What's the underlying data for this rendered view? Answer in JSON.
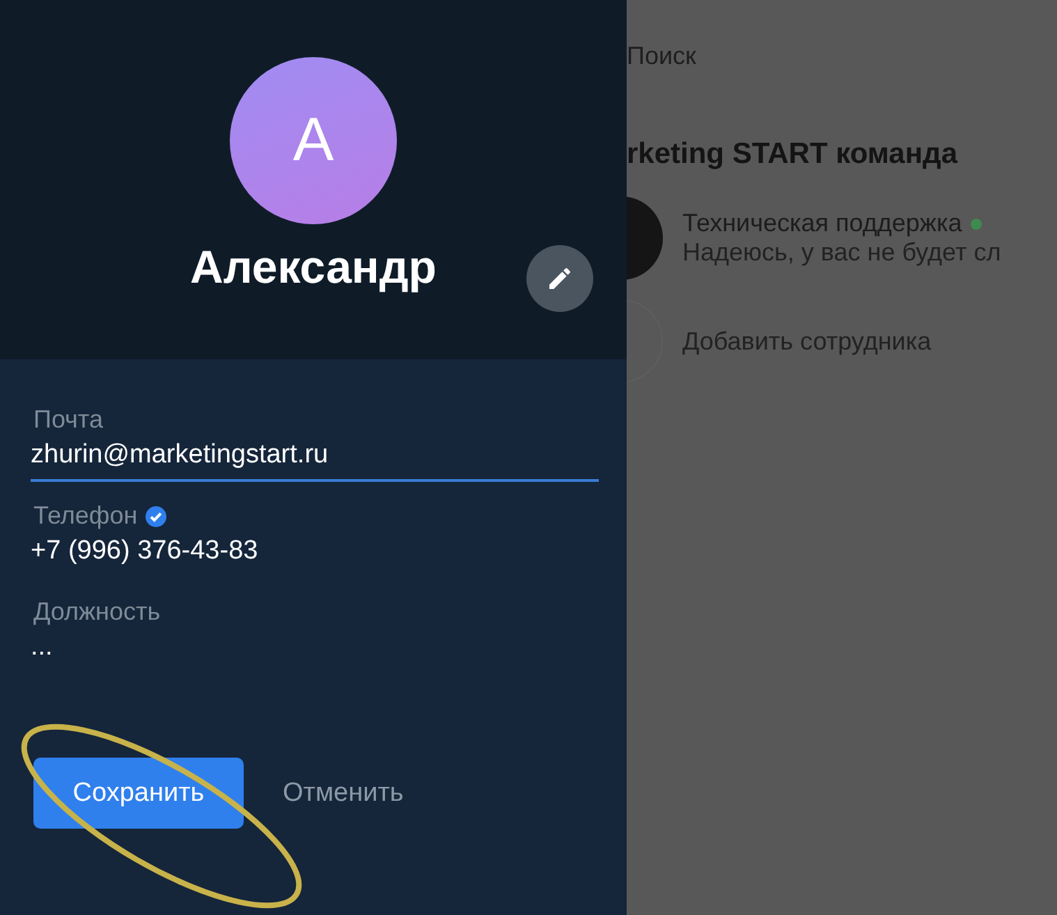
{
  "profile": {
    "avatar_letter": "A",
    "name": "Александр"
  },
  "fields": [
    {
      "label": "Почта",
      "value": "zhurin@marketingstart.ru",
      "focused": true,
      "verified": false
    },
    {
      "label": "Телефон",
      "value": "+7 (996) 376-43-83",
      "focused": false,
      "verified": true
    },
    {
      "label": "Должность",
      "value": "...",
      "focused": false,
      "verified": false
    }
  ],
  "buttons": {
    "save": "Сохранить",
    "cancel": "Отменить"
  },
  "background": {
    "search": {
      "placeholder": "Поиск"
    },
    "team_title": "rketing START команда",
    "contacts": [
      {
        "name": "Техническая поддержка",
        "message": "Надеюсь, у вас не будет сл",
        "online": true,
        "color": "#3f8a4f"
      }
    ],
    "add_employee": "Добавить сотрудника"
  }
}
